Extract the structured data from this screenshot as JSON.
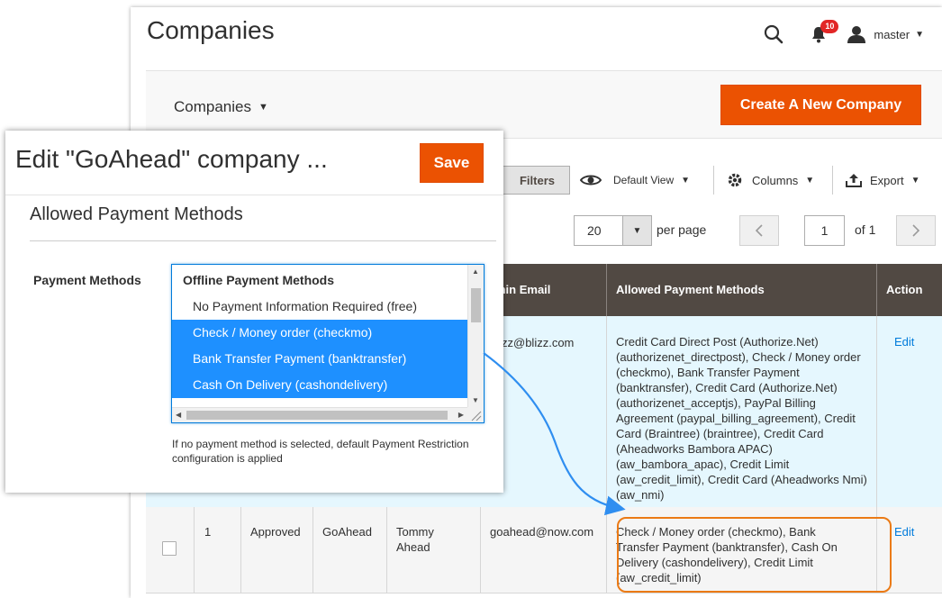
{
  "page": {
    "title": "Companies",
    "notification_count": "10",
    "user_name": "master"
  },
  "page_actions": {
    "switcher_label": "Companies",
    "create_button": "Create A New Company"
  },
  "toolbar": {
    "filters_label": "Filters",
    "view_label": "Default View",
    "columns_label": "Columns",
    "export_label": "Export"
  },
  "pager": {
    "per_page_value": "20",
    "per_page_label": "per page",
    "current_page": "1",
    "of_label": "of 1"
  },
  "grid": {
    "columns": {
      "admin_email": "min Email",
      "allowed_payment_methods": "Allowed Payment Methods",
      "action": "Action"
    },
    "rows": [
      {
        "email": "blizz@blizz.com",
        "allowed_payment_methods": "Credit Card Direct Post (Authorize.Net) (authorizenet_directpost), Check / Money order (checkmo), Bank Transfer Payment (banktransfer), Credit Card (Authorize.Net) (authorizenet_acceptjs), PayPal Billing Agreement (paypal_billing_agreement), Credit Card (Braintree) (braintree), Credit Card (Aheadworks Bambora APAC) (aw_bambora_apac), Credit Limit (aw_credit_limit), Credit Card (Aheadworks Nmi) (aw_nmi)",
        "action": "Edit"
      },
      {
        "id": "1",
        "status": "Approved",
        "company_name": "GoAhead",
        "company_admin": "Tommy Ahead",
        "email": "goahead@now.com",
        "allowed_payment_methods": "Check / Money order (checkmo), Bank Transfer Payment (banktransfer), Cash On Delivery (cashondelivery), Credit Limit (aw_credit_limit)",
        "action": "Edit"
      }
    ]
  },
  "modal": {
    "title": "Edit \"GoAhead\" company ...",
    "save_button": "Save",
    "section_title": "Allowed Payment Methods",
    "field_label": "Payment Methods",
    "group_label": "Offline Payment Methods",
    "options": [
      {
        "label": "No Payment Information Required (free)",
        "selected": false
      },
      {
        "label": "Check / Money order (checkmo)",
        "selected": true
      },
      {
        "label": "Bank Transfer Payment (banktransfer)",
        "selected": true
      },
      {
        "label": "Cash On Delivery (cashondelivery)",
        "selected": true
      }
    ],
    "note": "If no payment method is selected, default Payment Restriction configuration is applied"
  },
  "colors": {
    "accent": "#eb5202",
    "grid_header": "#514943",
    "link": "#007bdb",
    "selected_option": "#1e90ff",
    "highlight": "#eb7a15",
    "arrow": "#2f8ef0"
  },
  "icons": [
    "search-icon",
    "bell-icon",
    "user-icon",
    "eye-icon",
    "gear-icon",
    "export-icon",
    "chevron-left-icon",
    "chevron-right-icon"
  ]
}
